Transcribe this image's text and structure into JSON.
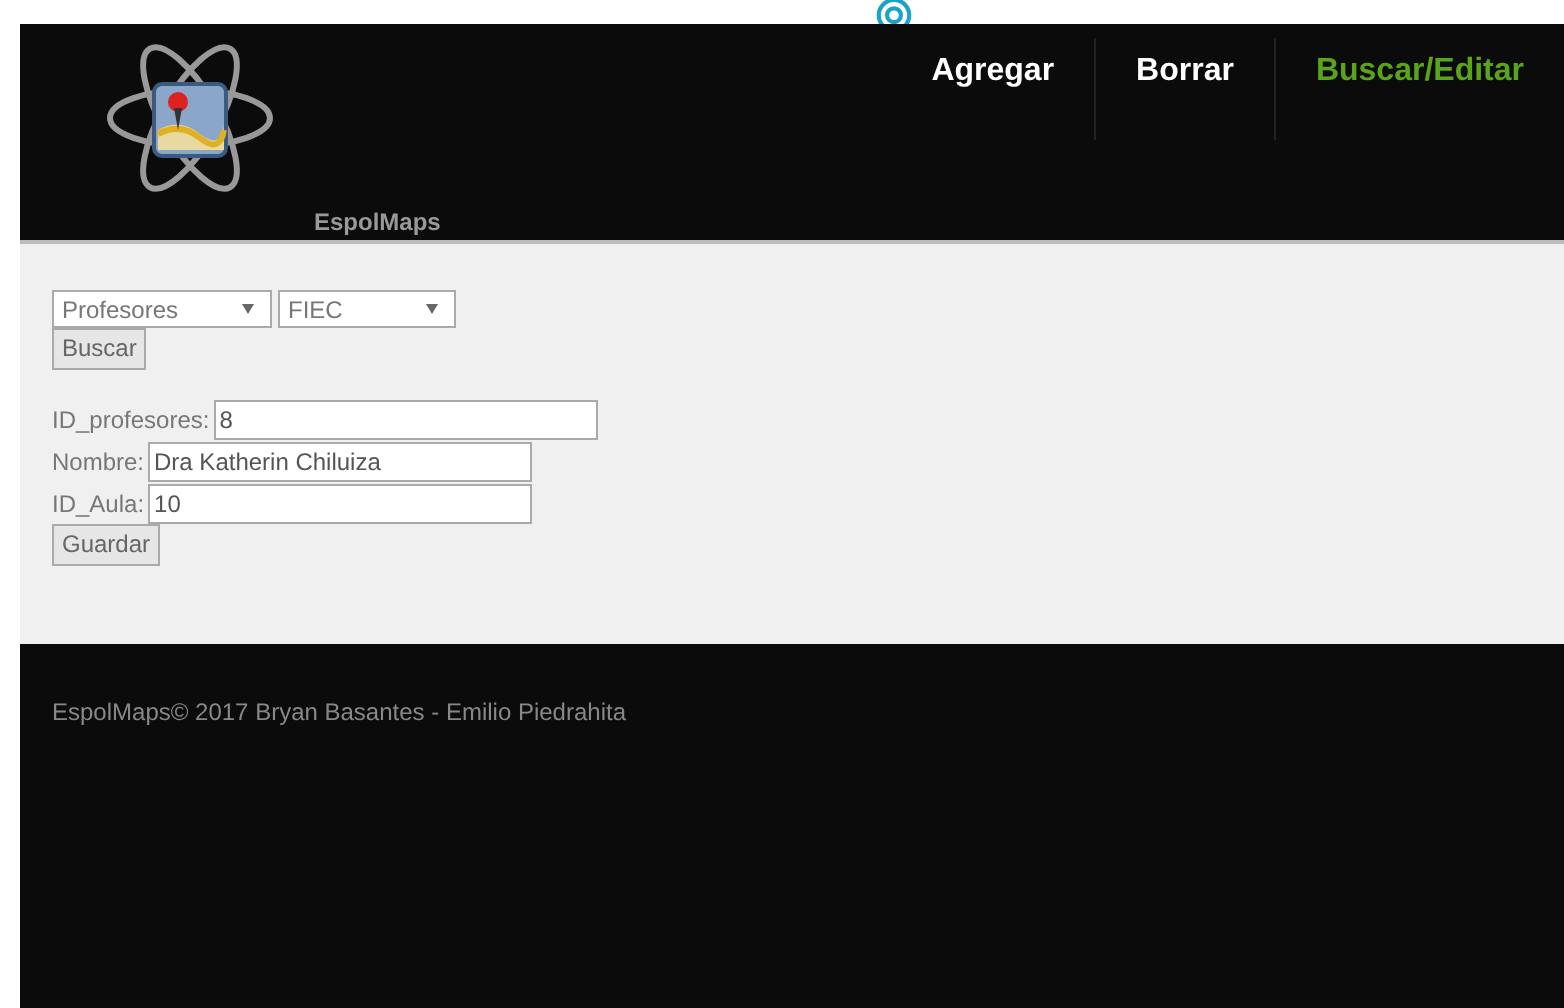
{
  "header": {
    "brand": "EspolMaps",
    "nav": [
      {
        "label": "Agregar",
        "selected": false
      },
      {
        "label": "Borrar",
        "selected": false
      },
      {
        "label": "Buscar/Editar",
        "selected": true
      }
    ]
  },
  "search": {
    "selects": [
      {
        "value": "Profesores"
      },
      {
        "value": "FIEC"
      }
    ],
    "button": "Buscar"
  },
  "form": {
    "fields": [
      {
        "label": "ID_profesores:",
        "value": "8"
      },
      {
        "label": "Nombre:",
        "value": "Dra Katherin Chiluiza"
      },
      {
        "label": "ID_Aula:",
        "value": "10"
      }
    ],
    "button": "Guardar"
  },
  "footer": {
    "text": "EspolMaps© 2017 Bryan Basantes - Emilio Piedrahita"
  }
}
